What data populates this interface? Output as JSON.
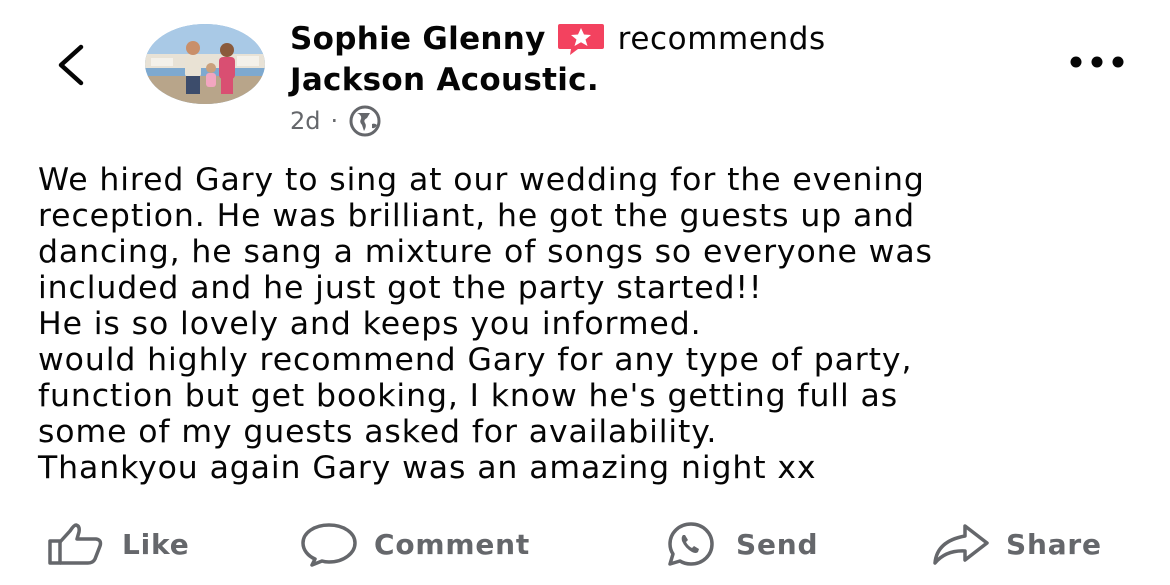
{
  "post": {
    "author": "Sophie Glenny",
    "action_text": "recommends",
    "page_name": "Jackson Acoustic.",
    "time": "2d",
    "separator": "·",
    "privacy_icon": "globe-icon",
    "recommend_icon": "recommend-star-icon",
    "body": "We hired Gary to sing at our wedding for the evening\nreception. He was brilliant, he got the guests up and\ndancing, he sang a mixture of songs so everyone was\nincluded and he just got the party started!!\nHe is so lovely and keeps you informed.\nwould highly recommend Gary for any type of party,\nfunction but get booking, I know he's getting full as\nsome of my guests asked for availability.\nThankyou again Gary was an amazing night xx"
  },
  "actions": {
    "like": "Like",
    "comment": "Comment",
    "send": "Send",
    "share": "Share"
  },
  "colors": {
    "text": "#050505",
    "muted": "#65676b",
    "recommend_badge": "#f3425f"
  }
}
